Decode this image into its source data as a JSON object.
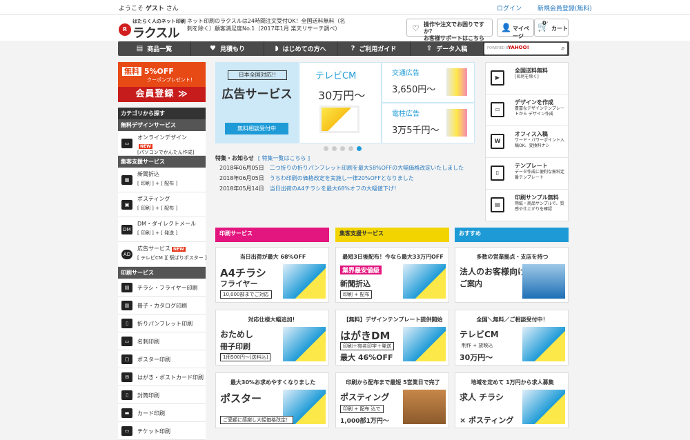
{
  "topbar": {
    "welcome_prefix": "ようこそ",
    "welcome_name": "ゲスト",
    "welcome_suffix": "さん",
    "login": "ログイン",
    "register": "新規会員登録(無料)"
  },
  "header": {
    "logo_sub": "はたらく人のネット印刷",
    "logo_main": "ラクスル",
    "text": "ネット印刷のラクスルは24時間注文受付OK！全国送料無料（名刺を除く）顧客満足度No.1（2017年1月 楽天リサーチ調べ）",
    "support_line1": "操作や注文でお困りですか？",
    "support_line2": "お客様サポートはこちら",
    "mypage": "マイページ",
    "cart_count": "0",
    "cart": "カート"
  },
  "nav": {
    "items": [
      {
        "label": "商品一覧",
        "icon": "list-icon"
      },
      {
        "label": "見積もり",
        "icon": "estimate-icon"
      },
      {
        "label": "はじめての方へ",
        "icon": "beginner-icon"
      },
      {
        "label": "ご利用ガイド",
        "icon": "guide-icon"
      },
      {
        "label": "データ入稿",
        "icon": "upload-icon"
      }
    ],
    "search_powered": "POWERED BY",
    "search_brand": "YAHOO!"
  },
  "promo": {
    "free": "無料",
    "off": "5%OFF",
    "coupon": "クーポンプレゼント！",
    "register": "会員登録 ≫"
  },
  "sidebar": {
    "heading": "カテゴリから探す",
    "groups": [
      {
        "title": "無料デザインサービス"
      },
      {
        "title": "集客支援サービス"
      },
      {
        "title": "印刷サービス"
      }
    ],
    "design_items": [
      {
        "label": "オンラインデザイン",
        "badge": "NEW",
        "sub": "[パソコンでかんたん作成]"
      }
    ],
    "attract_items": [
      {
        "label": "新聞折込",
        "sub": "[ 印刷 ] + [ 配布 ]"
      },
      {
        "label": "ポスティング",
        "sub": "[ 印刷 ] + [ 配布 ]"
      },
      {
        "label": "DM・ダイレクトメール",
        "sub": "[ 印刷 ] + [ 発送 ]"
      },
      {
        "label": "広告サービス",
        "badge": "NEW",
        "sub": "[ テレビCM ][ 駅ばりポスター ]"
      }
    ],
    "print_items": [
      {
        "label": "チラシ・フライヤー印刷"
      },
      {
        "label": "冊子・カタログ印刷"
      },
      {
        "label": "折りパンフレット印刷"
      },
      {
        "label": "名刺印刷"
      },
      {
        "label": "ポスター印刷"
      },
      {
        "label": "はがき・ポストカード印刷"
      },
      {
        "label": "封筒印刷"
      },
      {
        "label": "カード印刷"
      },
      {
        "label": "チケット印刷"
      }
    ]
  },
  "banner": {
    "badge": "日本全国対応!!",
    "title": "広告サービス",
    "button": "無料相談受付中",
    "tv_title": "テレビCM",
    "tv_price": "30万円〜",
    "transit_title": "交通広告",
    "transit_price": "3,650円〜",
    "pole_title": "電柱広告",
    "pole_price": "3万5千円〜"
  },
  "news": {
    "heading": "特集・お知らせ",
    "more": "[ 特集一覧はこちら ]",
    "items": [
      {
        "date": "2018年06月05日",
        "text": "二つ折りの折りパンフレット印刷を最大58%OFFの大幅価格改定いたしました"
      },
      {
        "date": "2018年06月05日",
        "text": "うちわ印刷の価格改定を実施し一律20%OFFとなりました"
      },
      {
        "date": "2018年05月14日",
        "text": "当日出荷のA4チラシを最大68%オフの大幅値下げ！"
      }
    ]
  },
  "features": [
    {
      "title": "全国送料無料",
      "desc": "[名刺を除く]",
      "icon": "truck-icon"
    },
    {
      "title": "デザインを作成",
      "desc": "豊富なデザインテンプレートから デザイン作成",
      "icon": "online-design-icon"
    },
    {
      "title": "オフィス入稿",
      "desc": "ワード・パワーポイント入稿OK、変換料ナシ",
      "icon": "office-icon"
    },
    {
      "title": "テンプレート",
      "desc": "データ作成に便利な無料定番テンプレート",
      "icon": "template-icon"
    },
    {
      "title": "印刷サンプル無料",
      "desc": "用紙・商品サンプルで、質感や仕上がりを確認",
      "icon": "sample-icon"
    }
  ],
  "columns": [
    {
      "title": "印刷サービス"
    },
    {
      "title": "集客支援サービス"
    },
    {
      "title": "おすすめ"
    }
  ],
  "cards": [
    {
      "top": "当日出荷が最大 68%OFF",
      "main": "A4チラシ",
      "sub": "フライヤー",
      "box": "10,000部までご対応"
    },
    {
      "top": "最短3日後配布！今なら最大33万円OFF",
      "main": "業界最安値級",
      "sub": "新聞折込",
      "box": "印刷 + 配布"
    },
    {
      "top": "多数の営業拠点・支店を持つ",
      "main": "法人のお客様向けの",
      "sub": "ご案内",
      "box": ""
    },
    {
      "top": "対応仕様大幅追加！",
      "main": "おためし",
      "sub": "冊子印刷",
      "box": "1冊500円〜[送料込]"
    },
    {
      "top": "【無料】デザインテンプレート提供開始",
      "main": "はがきDM",
      "sub": "最大 46%OFF",
      "box": "印刷＋宛名印字＋発送"
    },
    {
      "top": "全国＼無料／ご相談受付中！",
      "main": "テレビCM",
      "sub": "30万円〜",
      "box": "制作 + 放映込"
    },
    {
      "top": "最大30%お求めやすくなりました",
      "main": "ポスター",
      "sub": "",
      "box": "ご愛顧に感謝し大幅価格改定！"
    },
    {
      "top": "印刷から配布まで最短 5営業日で完了",
      "main": "ポスティング",
      "sub": "1,000部1万円〜",
      "box": "印刷 + 配布 込で"
    },
    {
      "top": "地域を定めて 1万円から求人募集",
      "main": "求人 チラシ",
      "sub": "× ポスティング",
      "box": ""
    }
  ]
}
